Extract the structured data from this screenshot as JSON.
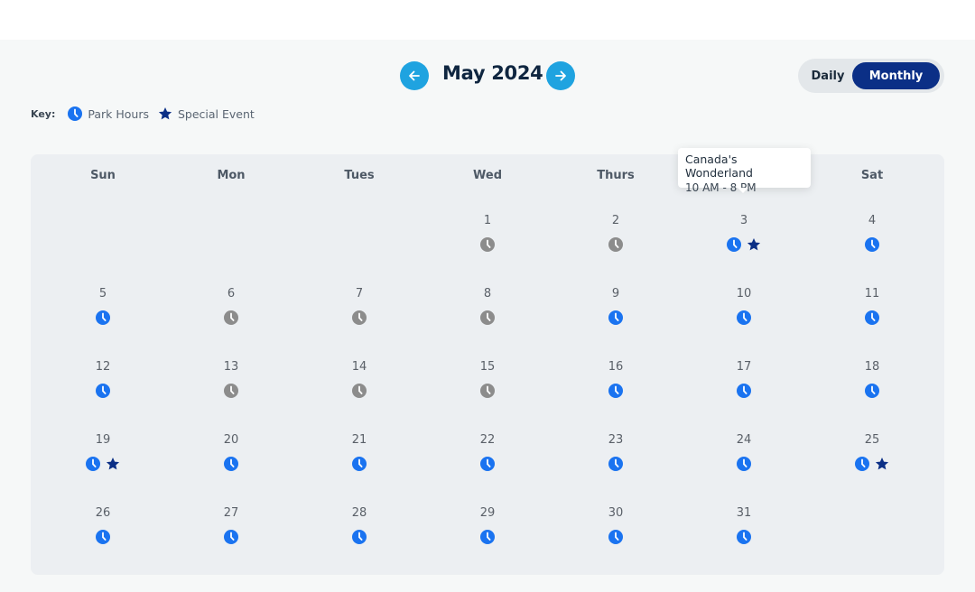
{
  "header": {
    "month_label": "May 2024",
    "prev_icon": "arrow-left-icon",
    "next_icon": "arrow-right-icon"
  },
  "view_toggle": {
    "daily": "Daily",
    "monthly": "Monthly",
    "selected": "Monthly"
  },
  "key": {
    "label": "Key:",
    "park_hours": "Park Hours",
    "special_event": "Special Event"
  },
  "colors": {
    "open": "#1a73f0",
    "closed": "#8c8c8c",
    "event": "#0b2f86",
    "nav": "#1fa3e0",
    "toggle_active": "#0b2f86"
  },
  "weekdays": [
    "Sun",
    "Mon",
    "Tues",
    "Wed",
    "Thurs",
    "",
    "Sat"
  ],
  "first_weekday_index": 3,
  "days": [
    {
      "d": "1",
      "hours": "closed"
    },
    {
      "d": "2",
      "hours": "closed"
    },
    {
      "d": "3",
      "hours": "open",
      "event": true
    },
    {
      "d": "4",
      "hours": "open"
    },
    {
      "d": "5",
      "hours": "open"
    },
    {
      "d": "6",
      "hours": "closed"
    },
    {
      "d": "7",
      "hours": "closed"
    },
    {
      "d": "8",
      "hours": "closed"
    },
    {
      "d": "9",
      "hours": "open"
    },
    {
      "d": "10",
      "hours": "open"
    },
    {
      "d": "11",
      "hours": "open"
    },
    {
      "d": "12",
      "hours": "open"
    },
    {
      "d": "13",
      "hours": "closed"
    },
    {
      "d": "14",
      "hours": "closed"
    },
    {
      "d": "15",
      "hours": "closed"
    },
    {
      "d": "16",
      "hours": "open"
    },
    {
      "d": "17",
      "hours": "open"
    },
    {
      "d": "18",
      "hours": "open"
    },
    {
      "d": "19",
      "hours": "open",
      "event": true
    },
    {
      "d": "20",
      "hours": "open"
    },
    {
      "d": "21",
      "hours": "open"
    },
    {
      "d": "22",
      "hours": "open"
    },
    {
      "d": "23",
      "hours": "open"
    },
    {
      "d": "24",
      "hours": "open"
    },
    {
      "d": "25",
      "hours": "open",
      "event": true
    },
    {
      "d": "26",
      "hours": "open"
    },
    {
      "d": "27",
      "hours": "open"
    },
    {
      "d": "28",
      "hours": "open"
    },
    {
      "d": "29",
      "hours": "open"
    },
    {
      "d": "30",
      "hours": "open"
    },
    {
      "d": "31",
      "hours": "open"
    }
  ],
  "tooltip": {
    "title": "Canada's Wonderland",
    "hours": "10 AM - 8 PM"
  }
}
